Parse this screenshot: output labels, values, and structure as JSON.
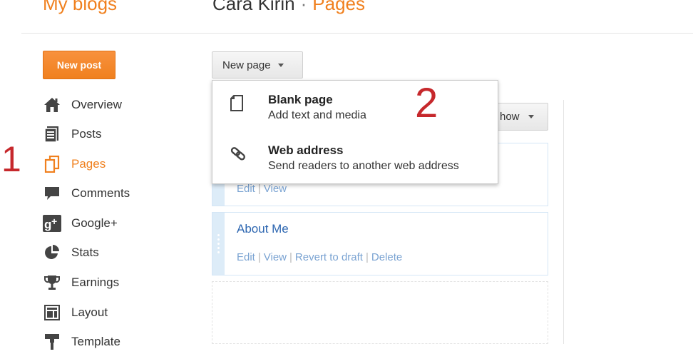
{
  "header": {
    "my_blogs": "My blogs",
    "blog_name": "Cara Kirin",
    "separator": "·",
    "current_section": "Pages"
  },
  "sidebar": {
    "new_post_label": "New post",
    "items": [
      {
        "label": "Overview",
        "icon": "home-icon"
      },
      {
        "label": "Posts",
        "icon": "posts-icon"
      },
      {
        "label": "Pages",
        "icon": "pages-icon",
        "active": true
      },
      {
        "label": "Comments",
        "icon": "comments-icon"
      },
      {
        "label": "Google+",
        "icon": "google-plus-icon"
      },
      {
        "label": "Stats",
        "icon": "stats-icon"
      },
      {
        "label": "Earnings",
        "icon": "trophy-icon"
      },
      {
        "label": "Layout",
        "icon": "layout-icon"
      },
      {
        "label": "Template",
        "icon": "template-icon"
      }
    ]
  },
  "annotations": {
    "one": "1",
    "two": "2"
  },
  "toolbar": {
    "new_page_label": "New page",
    "show_label": "how"
  },
  "new_page_menu": {
    "items": [
      {
        "title": "Blank page",
        "description": "Add text and media",
        "icon": "blank-page-icon"
      },
      {
        "title": "Web address",
        "description": "Send readers to another web address",
        "icon": "link-icon"
      }
    ]
  },
  "pages_list": {
    "rows": [
      {
        "title": "",
        "actions": [
          "Edit",
          "View"
        ]
      },
      {
        "title": "About Me",
        "actions": [
          "Edit",
          "View",
          "Revert to draft",
          "Delete"
        ]
      }
    ]
  },
  "colors": {
    "accent_orange": "#f0801e",
    "link_blue": "#2e67b1",
    "annotation_red": "#c6282c"
  }
}
